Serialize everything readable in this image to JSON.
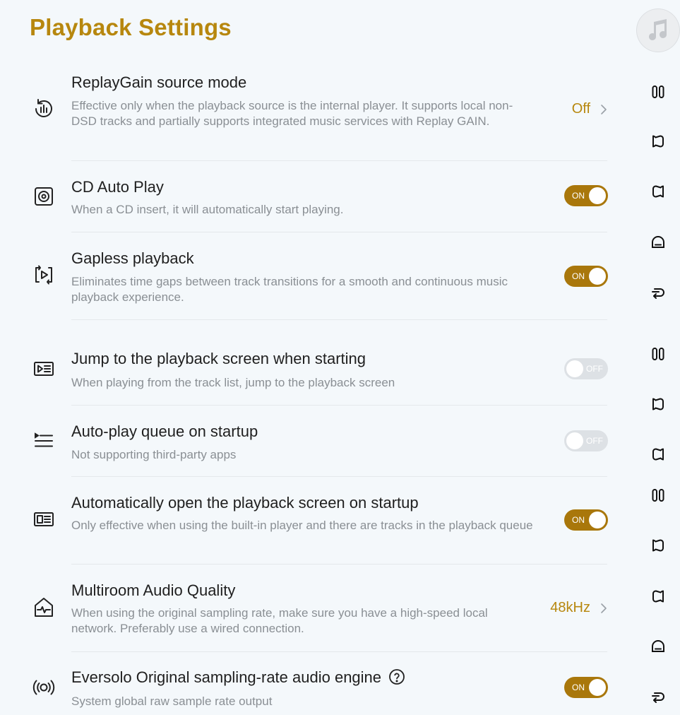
{
  "header": {
    "title": "Playback Settings"
  },
  "colors": {
    "accent": "#b7870e",
    "toggle_on": "#a9770b",
    "toggle_off": "#dde1e5",
    "background": "#f4f8fb"
  },
  "settings": [
    {
      "icon": "replaygain-icon",
      "title": "ReplayGain source mode",
      "desc": "Effective only when the playback source is the internal player. It supports local non-DSD tracks and partially supports integrated music services with Replay GAIN.",
      "control": "link",
      "value": "Off"
    },
    {
      "icon": "cd-icon",
      "title": "CD Auto Play",
      "desc": "When a CD insert, it will automatically start playing.",
      "control": "toggle",
      "state": "ON"
    },
    {
      "icon": "gapless-icon",
      "title": "Gapless playback",
      "desc": "Eliminates time gaps between track transitions for a smooth and continuous music playback experience.",
      "control": "toggle",
      "state": "ON"
    },
    {
      "icon": "playback-screen-icon",
      "title": "Jump to the playback screen when starting",
      "desc": "When playing from the track list, jump to the playback screen",
      "control": "toggle",
      "state": "OFF"
    },
    {
      "icon": "queue-icon",
      "title": "Auto-play queue on startup",
      "desc": "Not supporting third-party apps",
      "control": "toggle",
      "state": "OFF"
    },
    {
      "icon": "open-screen-icon",
      "title": "Automatically open the playback screen on startup",
      "desc": "Only effective when using the built-in player and there are tracks in the playback queue",
      "control": "toggle",
      "state": "ON"
    },
    {
      "icon": "multiroom-icon",
      "title": "Multiroom Audio Quality",
      "desc": "When using the original sampling rate, make sure you have a high-speed local network. Preferably use a wired connection.",
      "control": "link",
      "value": "48kHz"
    },
    {
      "icon": "audio-engine-icon",
      "title": "Eversolo Original sampling-rate audio engine",
      "desc": "System global raw sample rate output",
      "control": "toggle",
      "state": "ON",
      "has_help": true
    }
  ],
  "rail": {
    "avatar_icon": "music-note-icon",
    "buttons": [
      "pause-icon",
      "previous-icon",
      "next-icon",
      "home-icon",
      "back-icon",
      "pause-icon",
      "previous-icon",
      "next-icon",
      "pause-icon",
      "previous-icon",
      "next-icon",
      "home-icon",
      "back-icon"
    ]
  }
}
